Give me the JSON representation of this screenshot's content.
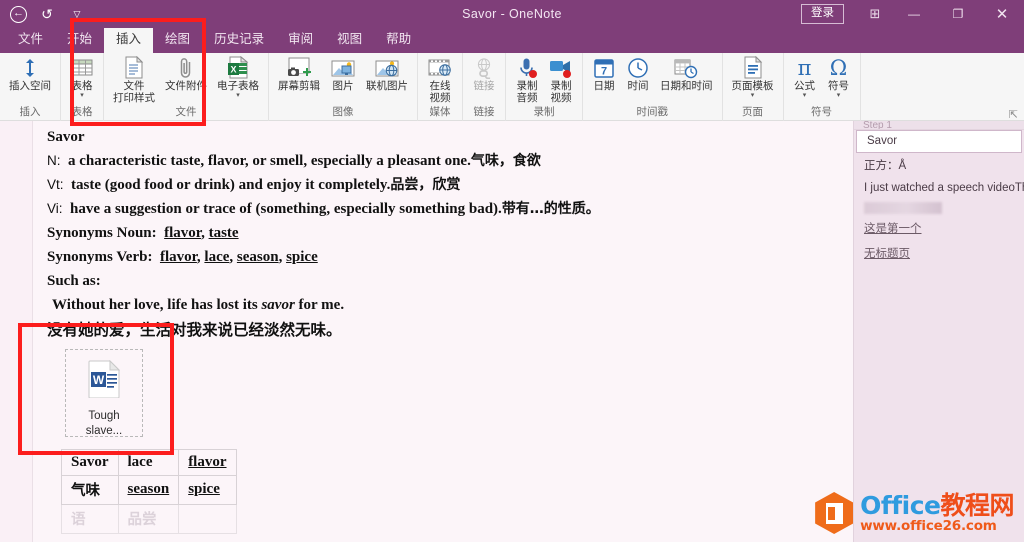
{
  "window": {
    "title": "Savor  -  OneNote",
    "signin_label": "登录",
    "quick_access": [
      {
        "name": "back-button",
        "glyph": "←"
      },
      {
        "name": "undo-button",
        "glyph": "↺"
      },
      {
        "name": "customize-qat-button",
        "glyph": "▽"
      }
    ],
    "controls": {
      "ribbon_display_options": "⊞",
      "minimize": "—",
      "restore": "❐",
      "close": "✕"
    }
  },
  "tabs": [
    {
      "label": "文件",
      "active": false
    },
    {
      "label": "开始",
      "active": false
    },
    {
      "label": "插入",
      "active": true
    },
    {
      "label": "绘图",
      "active": false
    },
    {
      "label": "历史记录",
      "active": false
    },
    {
      "label": "审阅",
      "active": false
    },
    {
      "label": "视图",
      "active": false
    },
    {
      "label": "帮助",
      "active": false
    }
  ],
  "ribbon": {
    "groups": [
      {
        "name": "insert",
        "label": "插入",
        "items": [
          {
            "label": "插入空间",
            "icon": "insert-space-icon",
            "caret": false,
            "disabled": false
          }
        ]
      },
      {
        "name": "table",
        "label": "表格",
        "items": [
          {
            "label": "表格",
            "icon": "table-icon",
            "caret": true,
            "disabled": false
          }
        ]
      },
      {
        "name": "file",
        "label": "文件",
        "items": [
          {
            "label": "文件\n打印样式",
            "icon": "file-printout-icon",
            "caret": false,
            "disabled": false
          },
          {
            "label": "文件附件",
            "icon": "paperclip-icon",
            "caret": false,
            "disabled": false
          },
          {
            "label": "电子表格",
            "icon": "spreadsheet-icon",
            "caret": true,
            "disabled": false
          }
        ]
      },
      {
        "name": "images",
        "label": "图像",
        "items": [
          {
            "label": "屏幕剪辑",
            "icon": "screen-clipping-icon",
            "caret": false,
            "disabled": false
          },
          {
            "label": "图片",
            "icon": "picture-icon",
            "caret": false,
            "disabled": false
          },
          {
            "label": "联机图片",
            "icon": "online-picture-icon",
            "caret": false,
            "disabled": false
          }
        ]
      },
      {
        "name": "media",
        "label": "媒体",
        "items": [
          {
            "label": "在线\n视频",
            "icon": "online-video-icon",
            "caret": false,
            "disabled": false
          }
        ]
      },
      {
        "name": "link",
        "label": "链接",
        "items": [
          {
            "label": "链接",
            "icon": "link-icon",
            "caret": false,
            "disabled": true
          }
        ]
      },
      {
        "name": "recording",
        "label": "录制",
        "items": [
          {
            "label": "录制\n音频",
            "icon": "record-audio-icon",
            "caret": false,
            "disabled": false
          },
          {
            "label": "录制\n视频",
            "icon": "record-video-icon",
            "caret": false,
            "disabled": false
          }
        ]
      },
      {
        "name": "timestamp",
        "label": "时间戳",
        "items": [
          {
            "label": "日期",
            "icon": "date-icon",
            "caret": false,
            "disabled": false
          },
          {
            "label": "时间",
            "icon": "time-icon",
            "caret": false,
            "disabled": false
          },
          {
            "label": "日期和时间",
            "icon": "date-time-icon",
            "caret": false,
            "disabled": false
          }
        ]
      },
      {
        "name": "page",
        "label": "页面",
        "items": [
          {
            "label": "页面模板",
            "icon": "page-template-icon",
            "caret": true,
            "disabled": false
          }
        ]
      },
      {
        "name": "symbols",
        "label": "符号",
        "items": [
          {
            "label": "公式",
            "icon": "equation-pi-icon",
            "caret": true,
            "disabled": false
          },
          {
            "label": "符号",
            "icon": "symbol-omega-icon",
            "caret": true,
            "disabled": false
          }
        ]
      }
    ],
    "dialog_launcher": "⇱"
  },
  "note": {
    "heading": "Savor",
    "lines": [
      {
        "pos": "N:",
        "en": "a characteristic taste, flavor, or smell, especially a pleasant one.",
        "zh": "气味，食欲"
      },
      {
        "pos": "Vt:",
        "en": "taste (good food or drink) and enjoy it completely.",
        "zh": "品尝，欣赏"
      },
      {
        "pos": "Vi:",
        "en": "have a suggestion or trace of (something, especially something bad).",
        "zh": "带有…的性质。"
      }
    ],
    "syn_noun_label": "Synonyms Noun:",
    "syn_noun_words": [
      "flavor",
      "taste"
    ],
    "syn_verb_label": "Synonyms Verb:",
    "syn_verb_words": [
      "flavor",
      "lace",
      "season",
      "spice"
    ],
    "such_as": "Such as:",
    "example_pre": "Without her love, life has lost its ",
    "example_italic": "savor",
    "example_post": " for me.",
    "example_zh": "没有她的爱，生活对我来说已经淡然无味。",
    "attachment": {
      "icon": "word-document-icon",
      "name_line1": "Tough",
      "name_line2": "slave..."
    },
    "table": {
      "rows": [
        [
          {
            "t": "Savor",
            "cn": false,
            "u": false,
            "faded": false
          },
          {
            "t": "lace",
            "cn": false,
            "u": false,
            "faded": false
          },
          {
            "t": "flavor",
            "cn": false,
            "u": true,
            "faded": false
          }
        ],
        [
          {
            "t": "气味",
            "cn": true,
            "u": false,
            "faded": false
          },
          {
            "t": "season",
            "cn": false,
            "u": true,
            "faded": false
          },
          {
            "t": "spice",
            "cn": false,
            "u": true,
            "faded": false
          }
        ],
        [
          {
            "t": "语",
            "cn": true,
            "u": false,
            "faded": true
          },
          {
            "t": "品尝",
            "cn": true,
            "u": false,
            "faded": true
          },
          {
            "t": "",
            "cn": false,
            "u": false,
            "faded": true
          }
        ]
      ]
    }
  },
  "right_panel": {
    "partial_top": "Step 1",
    "items": [
      {
        "label": "Savor",
        "selected": true,
        "underline": false,
        "blurred": false
      },
      {
        "label": "正方：Å",
        "selected": false,
        "underline": false,
        "blurred": false
      },
      {
        "label": "I just watched a speech videoTh",
        "selected": false,
        "underline": false,
        "blurred": false
      },
      {
        "label": "",
        "selected": false,
        "underline": false,
        "blurred": true
      },
      {
        "label": "这是第一个",
        "selected": false,
        "underline": true,
        "blurred": false
      },
      {
        "label": "无标题页",
        "selected": false,
        "underline": true,
        "blurred": false
      }
    ]
  },
  "annotations": [
    {
      "name": "annotation-box-ribbon",
      "color": "#fc1d1d"
    },
    {
      "name": "annotation-box-attachment",
      "color": "#fc1d1d"
    }
  ],
  "watermark": {
    "line1_blue": "Office",
    "line1_red": "教程网",
    "line2": "www.office26.com"
  }
}
